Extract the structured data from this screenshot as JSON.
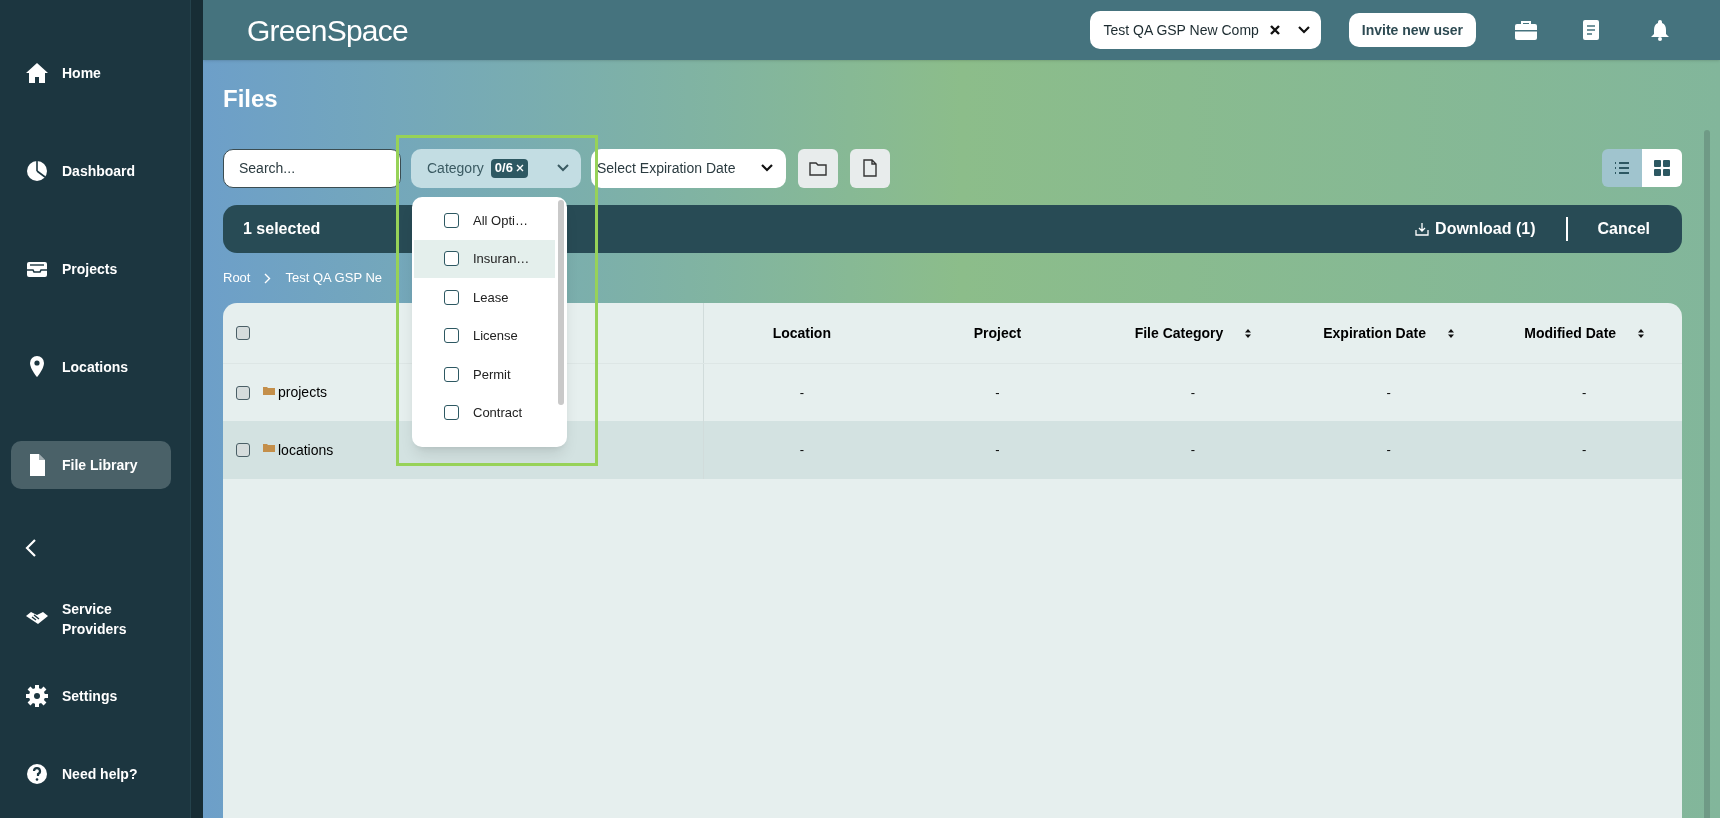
{
  "sidebar": {
    "items": [
      {
        "kind": "home",
        "label": "Home",
        "selected": false
      },
      {
        "kind": "dashboard",
        "label": "Dashboard",
        "selected": false
      },
      {
        "kind": "projects",
        "label": "Projects",
        "selected": false
      },
      {
        "kind": "locations",
        "label": "Locations",
        "selected": false
      },
      {
        "kind": "files",
        "label": "File Library",
        "selected": true
      },
      {
        "kind": "collapse"
      },
      {
        "kind": "providers",
        "label": "Service Providers",
        "selected": false
      },
      {
        "kind": "settings",
        "label": "Settings",
        "selected": false
      },
      {
        "kind": "help",
        "label": "Need help?",
        "selected": false
      }
    ]
  },
  "top_bar": {
    "logo": "GreenSpace",
    "company_select": {
      "value": "Test QA GSP New Comp"
    },
    "invite_button": "Invite new user"
  },
  "page_title": "Files",
  "filters": {
    "search": {
      "placeholder": "Search..."
    },
    "category": {
      "label": "Category",
      "count": "0/6",
      "expanded": true,
      "options": [
        {
          "label": "All Opti…",
          "checked": false,
          "highlighted": false
        },
        {
          "label": "Insuran…",
          "checked": false,
          "highlighted": true
        },
        {
          "label": "Lease",
          "checked": false,
          "highlighted": false
        },
        {
          "label": "License",
          "checked": false,
          "highlighted": false
        },
        {
          "label": "Permit",
          "checked": false,
          "highlighted": false
        },
        {
          "label": "Contract",
          "checked": false,
          "highlighted": false
        }
      ]
    },
    "expiration": {
      "placeholder": "Select Expiration Date"
    },
    "view_toggle": [
      {
        "kind": "list",
        "selected": true
      },
      {
        "kind": "grid",
        "selected": false
      }
    ]
  },
  "selection_bar": {
    "count": "1 selected",
    "download": "Download (1)",
    "cancel": "Cancel"
  },
  "breadcrumb": [
    "Root",
    "Test QA GSP Ne"
  ],
  "table": {
    "header_checked": false,
    "columns": [
      {
        "label": "Location",
        "sortable": false
      },
      {
        "label": "Project",
        "sortable": false
      },
      {
        "label": "File Category",
        "sortable": true
      },
      {
        "label": "Expiration Date",
        "sortable": true
      },
      {
        "label": "Modified Date",
        "sortable": true
      }
    ],
    "rows": [
      {
        "name": "projects",
        "checked": false,
        "highlighted": false,
        "cells": [
          "-",
          "-",
          "-",
          "-",
          "-"
        ]
      },
      {
        "name": "locations",
        "checked": false,
        "highlighted": true,
        "cells": [
          "-",
          "-",
          "-",
          "-",
          "-"
        ]
      }
    ]
  }
}
